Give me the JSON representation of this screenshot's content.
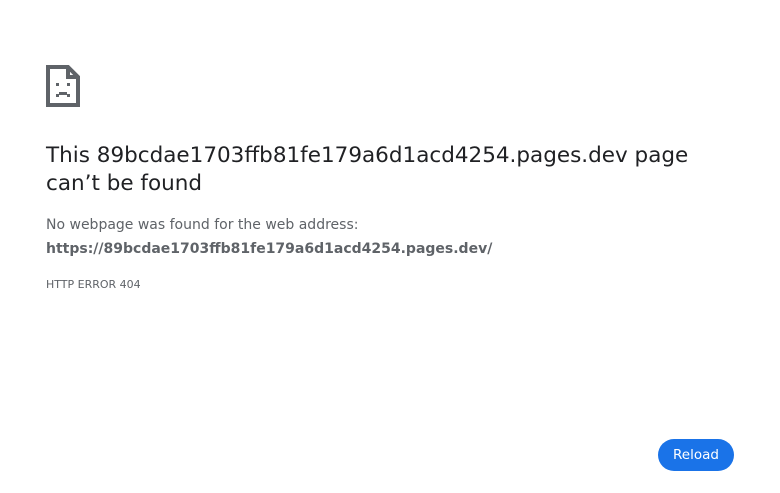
{
  "error_page": {
    "icon": "sad-document-icon",
    "heading": "This 89bcdae1703ffb81fe179a6d1acd4254.pages.dev page can’t be found",
    "description": "No webpage was found for the web address:",
    "url": "https://89bcdae1703ffb81fe179a6d1acd4254.pages.dev/",
    "error_code": "HTTP ERROR 404",
    "reload_label": "Reload"
  },
  "colors": {
    "icon": "#5f6368",
    "heading": "#202124",
    "body_text": "#5f6368",
    "button_bg": "#1a73e8",
    "button_text": "#ffffff",
    "background": "#ffffff"
  }
}
